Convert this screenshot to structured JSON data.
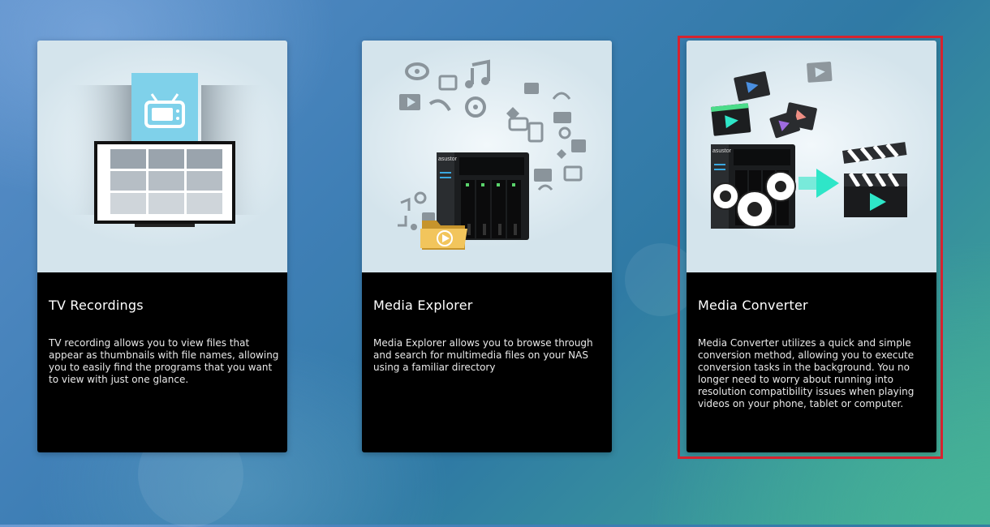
{
  "colors": {
    "selection_border": "#d6232f",
    "card_info_bg": "#000000",
    "illustration_bg": "#d4e4ec",
    "accent_cyan": "#2ee6c8"
  },
  "cards": [
    {
      "title": "TV Recordings",
      "description": "TV recording allows you to view files that appear as thumbnails with file names, allowing you to easily find the programs that you want to view with just one glance.",
      "icon": "tv-icon",
      "selected": false
    },
    {
      "title": "Media Explorer",
      "description": "Media Explorer allows you to browse through and search for multimedia files on your NAS using a familiar directory",
      "icon": "nas-media-icon",
      "brand_text": "asustor",
      "selected": false
    },
    {
      "title": "Media Converter",
      "description": "Media Converter utilizes a quick and simple conversion method, allowing you to execute conversion tasks in the background. You no longer need to worry about running into resolution compatibility issues when playing videos on your phone, tablet or computer.",
      "icon": "media-converter-icon",
      "brand_text": "asustor",
      "selected": true
    }
  ]
}
